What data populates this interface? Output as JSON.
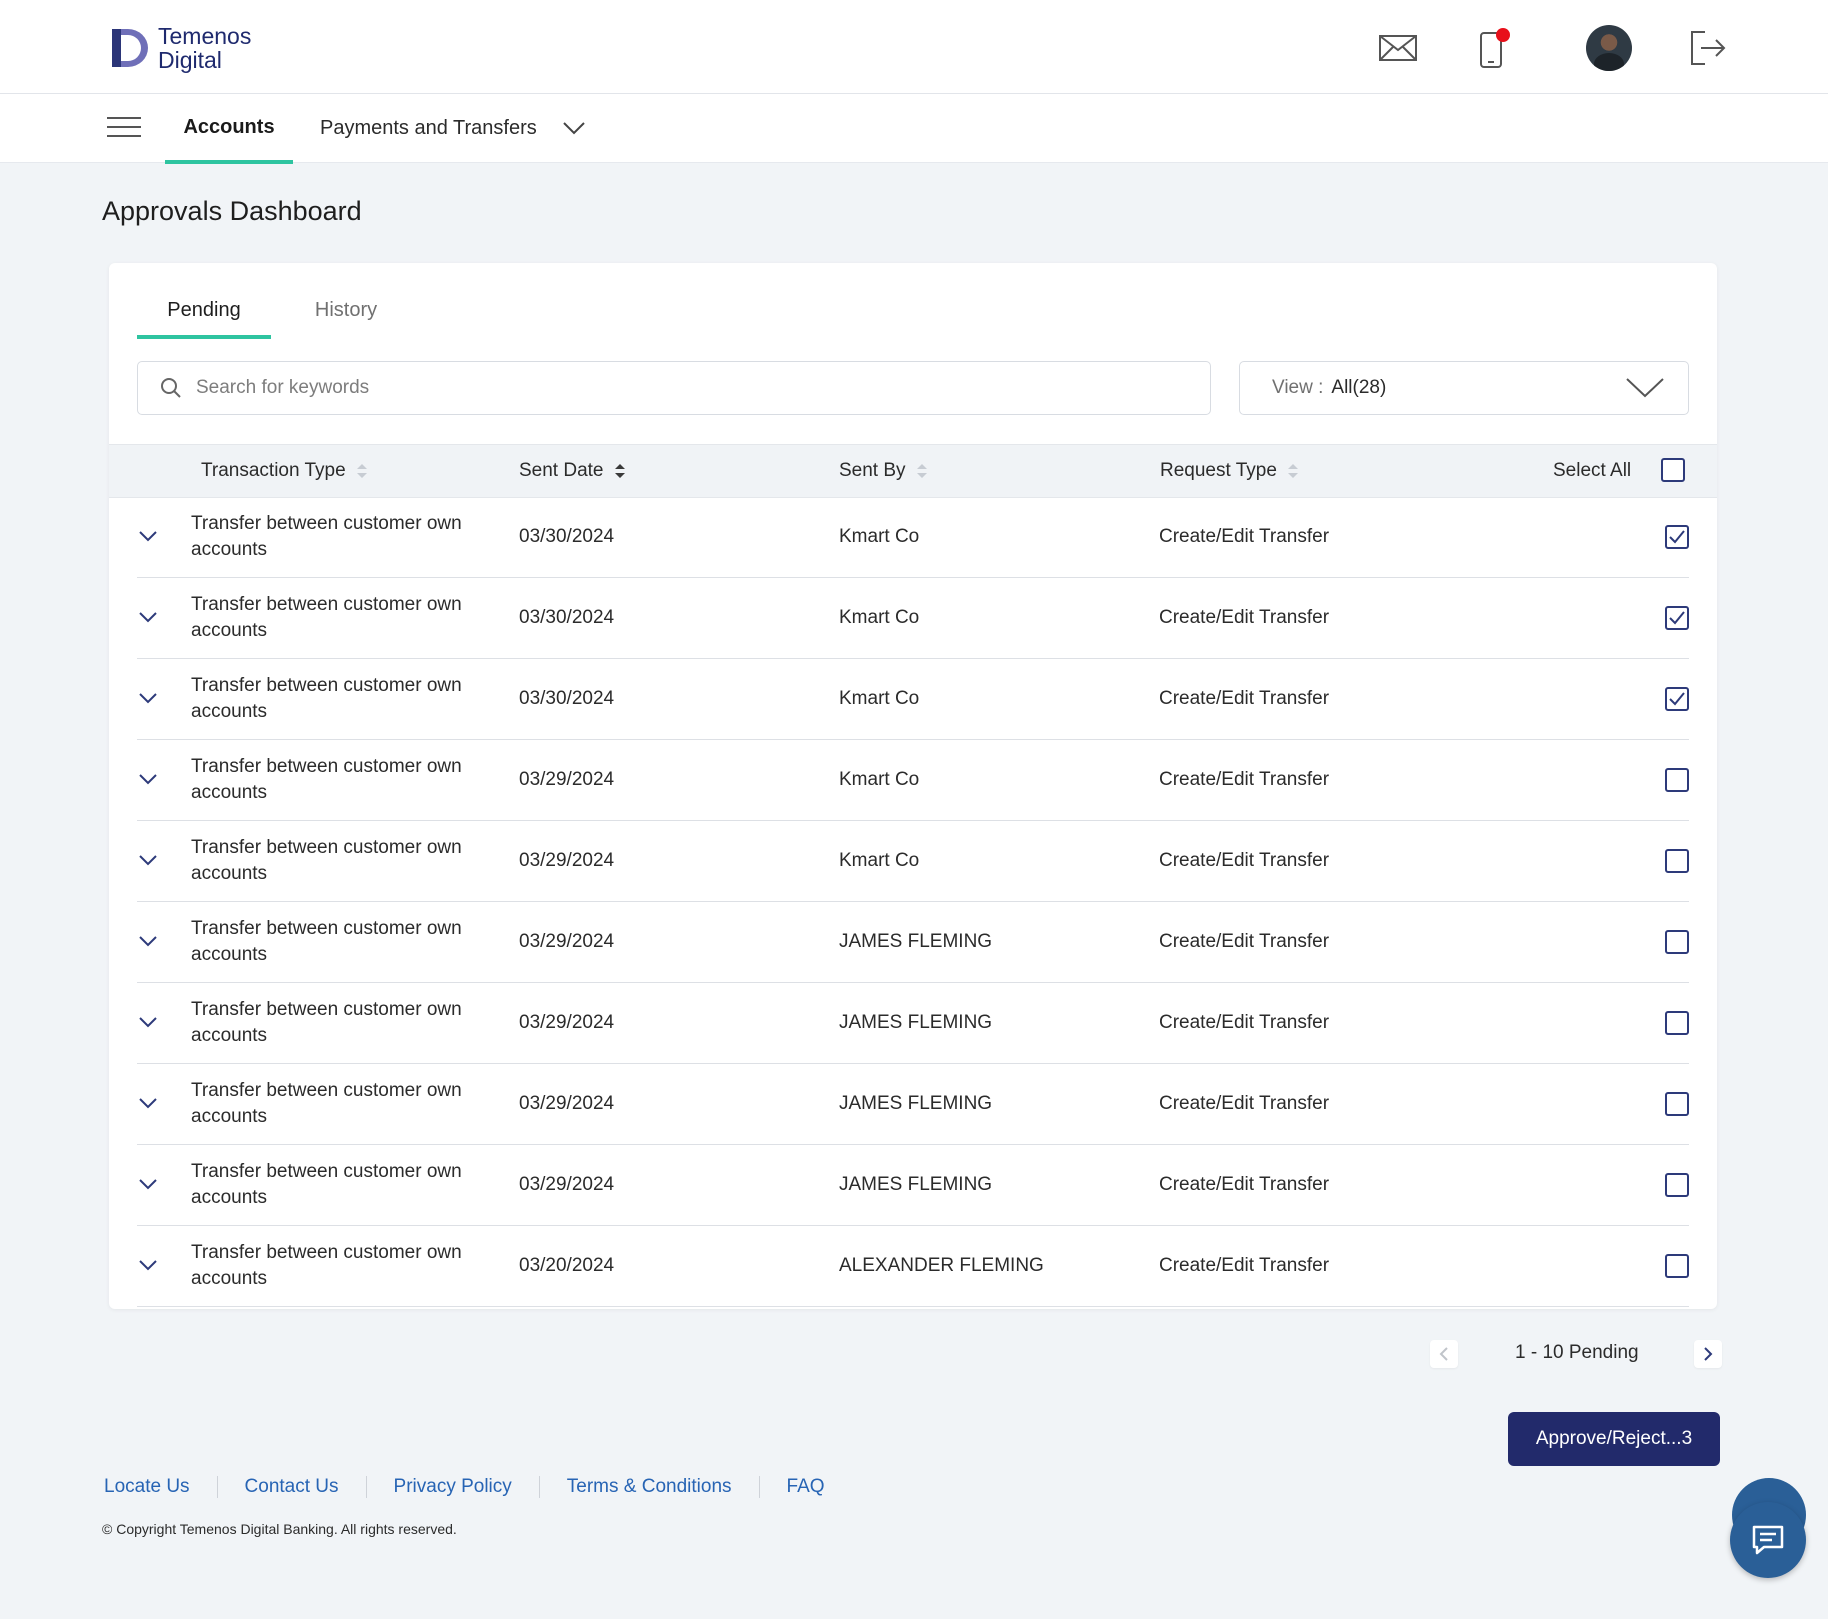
{
  "brand": {
    "line1": "Temenos",
    "line2": "Digital",
    "color": "#1f2a6e",
    "accent": "#2ec4a0"
  },
  "header_icons": [
    "mail-icon",
    "mobile-icon",
    "avatar",
    "logout-icon"
  ],
  "nav": {
    "accounts": "Accounts",
    "payments": "Payments and Transfers"
  },
  "page": {
    "title": "Approvals Dashboard"
  },
  "tabs": {
    "pending": "Pending",
    "history": "History"
  },
  "search": {
    "placeholder": "Search for keywords",
    "value": ""
  },
  "view": {
    "label": "View :",
    "value": "All(28)"
  },
  "table": {
    "headers": {
      "type": "Transaction Type",
      "date": "Sent Date",
      "by": "Sent By",
      "request": "Request Type",
      "select_all": "Select All"
    },
    "rows": [
      {
        "type": "Transfer between customer own accounts",
        "date": "03/30/2024",
        "by": "Kmart Co",
        "request": "Create/Edit Transfer",
        "checked": true
      },
      {
        "type": "Transfer between customer own accounts",
        "date": "03/30/2024",
        "by": "Kmart Co",
        "request": "Create/Edit Transfer",
        "checked": true
      },
      {
        "type": "Transfer between customer own accounts",
        "date": "03/30/2024",
        "by": "Kmart Co",
        "request": "Create/Edit Transfer",
        "checked": true
      },
      {
        "type": "Transfer between customer own accounts",
        "date": "03/29/2024",
        "by": "Kmart Co",
        "request": "Create/Edit Transfer",
        "checked": false
      },
      {
        "type": "Transfer between customer own accounts",
        "date": "03/29/2024",
        "by": "Kmart Co",
        "request": "Create/Edit Transfer",
        "checked": false
      },
      {
        "type": "Transfer between customer own accounts",
        "date": "03/29/2024",
        "by": "JAMES FLEMING",
        "request": "Create/Edit Transfer",
        "checked": false
      },
      {
        "type": "Transfer between customer own accounts",
        "date": "03/29/2024",
        "by": "JAMES FLEMING",
        "request": "Create/Edit Transfer",
        "checked": false
      },
      {
        "type": "Transfer between customer own accounts",
        "date": "03/29/2024",
        "by": "JAMES FLEMING",
        "request": "Create/Edit Transfer",
        "checked": false
      },
      {
        "type": "Transfer between customer own accounts",
        "date": "03/29/2024",
        "by": "JAMES FLEMING",
        "request": "Create/Edit Transfer",
        "checked": false
      },
      {
        "type": "Transfer between customer own accounts",
        "date": "03/20/2024",
        "by": "ALEXANDER FLEMING",
        "request": "Create/Edit Transfer",
        "checked": false
      }
    ]
  },
  "pagination": {
    "text": "1 - 10 Pending"
  },
  "actions": {
    "approve_label": "Approve/Reject...3",
    "color": "#222a6b"
  },
  "footer": {
    "links": [
      "Locate Us",
      "Contact Us",
      "Privacy Policy",
      "Terms & Conditions",
      "FAQ"
    ],
    "copyright": "© Copyright Temenos Digital Banking. All rights reserved."
  }
}
